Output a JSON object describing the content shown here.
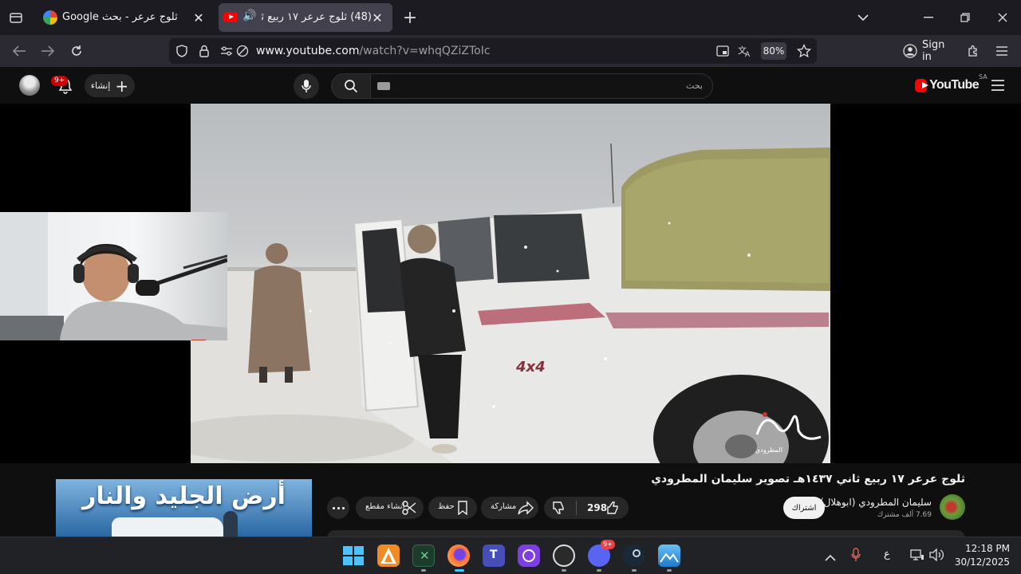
{
  "browser": {
    "tabs": [
      {
        "title": "ثلوج عرعر - بحث Google",
        "active": false
      },
      {
        "title": "(48) ثلوج عرعر ١٧ ربيع ثاني",
        "active": true
      }
    ],
    "url_host": "www.youtube.com",
    "url_path": "/watch?v=whqQZiZToIc",
    "zoom": "80%",
    "sign_in": "Sign in"
  },
  "youtube": {
    "logo": "YouTube",
    "country": "SA",
    "search_placeholder": "بحث",
    "create_label": "إنشاء",
    "notifications_badge": "9+"
  },
  "video": {
    "title": "ثلوج عرعر ١٧ ربيع ثاني ١٤٣٧هـ تصوير سليمان المطرودي",
    "channel_name": "سليمان المطرودي (ابوهلال)",
    "subscribers": "7.69 ألف مشترك",
    "subscribe_label": "اشتراك",
    "likes": "298",
    "share_label": "مشاركة",
    "save_label": "حفظ",
    "clip_label": "إنشاء مقطع",
    "watermark": "المطرودي",
    "truck_badge": "4x4"
  },
  "recommended": {
    "thumbnail_title": "أرض الجليد والنار"
  },
  "taskbar": {
    "language": "ع",
    "time": "12:18 PM",
    "date": "30/12/2025",
    "discord_badge": "9+"
  },
  "colors": {
    "youtube_red": "#ff0000",
    "tab_active": "#42414d",
    "page_bg": "#0f0f0f"
  }
}
